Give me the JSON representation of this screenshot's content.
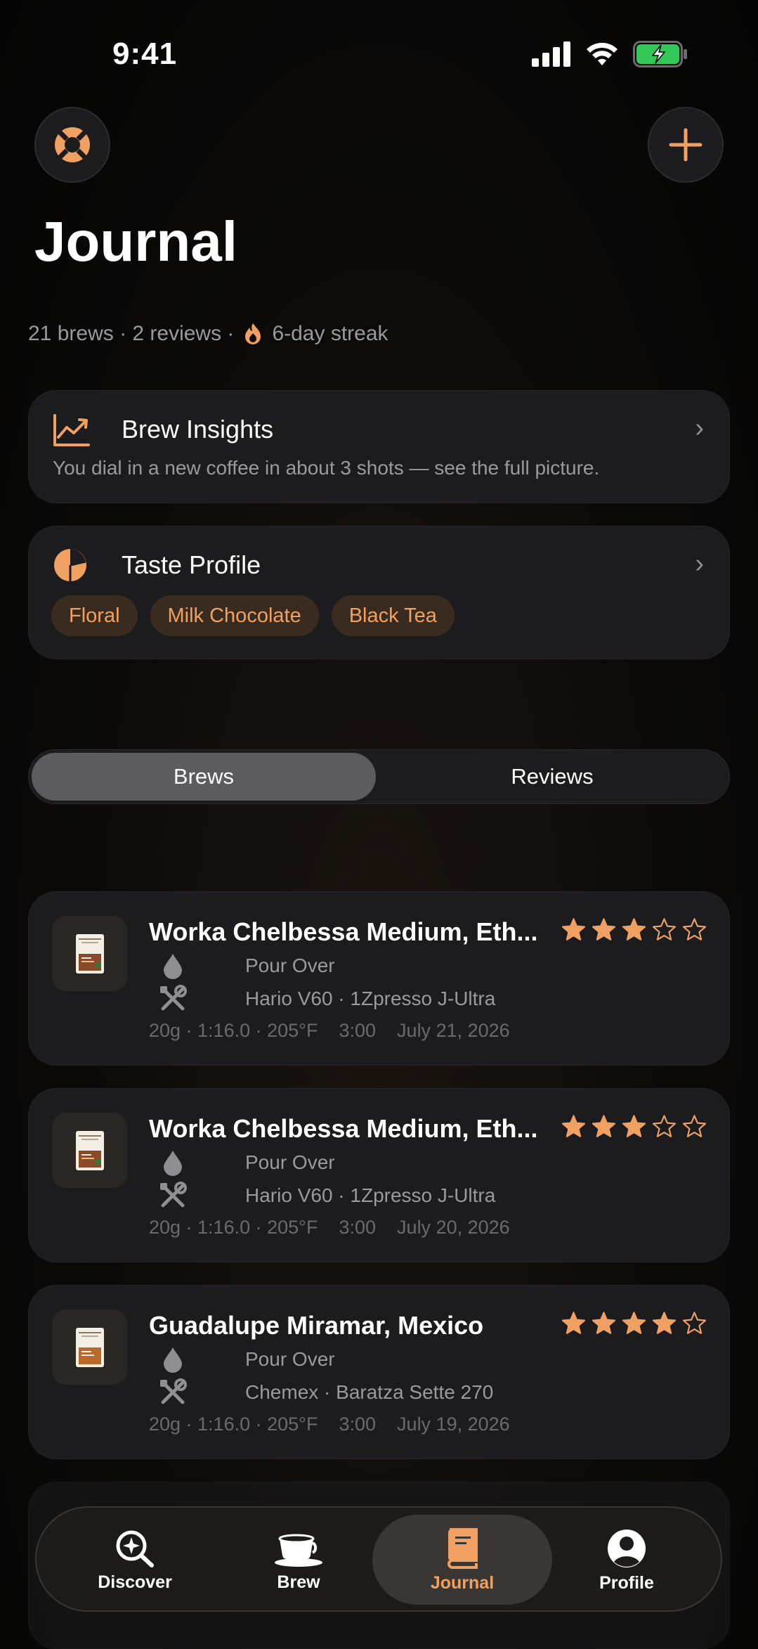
{
  "status": {
    "time": "9:41"
  },
  "header": {
    "title": "Journal"
  },
  "stats": {
    "summary": "21 brews · 2 reviews ·",
    "streak": "6-day streak"
  },
  "insights": {
    "title": "Brew Insights",
    "subtitle": "You dial in a new coffee in about 3 shots — see the full picture."
  },
  "taste": {
    "title": "Taste Profile",
    "tags": [
      "Floral",
      "Milk Chocolate",
      "Black Tea"
    ]
  },
  "segment": {
    "brews": "Brews",
    "reviews": "Reviews"
  },
  "brews": [
    {
      "name": "Worka Chelbessa Medium, Eth...",
      "rating": 3,
      "method": "Pour Over",
      "gear": "Hario V60 · 1Zpresso J-Ultra",
      "params": "20g · 1:16.0 · 205°F",
      "time": "3:00",
      "date": "July 21, 2026"
    },
    {
      "name": "Worka Chelbessa Medium, Eth...",
      "rating": 3,
      "method": "Pour Over",
      "gear": "Hario V60 · 1Zpresso J-Ultra",
      "params": "20g · 1:16.0 · 205°F",
      "time": "3:00",
      "date": "July 20, 2026"
    },
    {
      "name": "Guadalupe Miramar, Mexico",
      "rating": 4,
      "method": "Pour Over",
      "gear": "Chemex · Baratza Sette 270",
      "params": "20g · 1:16.0 · 205°F",
      "time": "3:00",
      "date": "July 19, 2026"
    }
  ],
  "tabs": {
    "discover": "Discover",
    "brew": "Brew",
    "journal": "Journal",
    "profile": "Profile"
  },
  "colors": {
    "accent": "#f0a060",
    "background": "#0b0a09",
    "card": "#1c1c1e"
  },
  "icons": {
    "help": "lifebuoy-icon",
    "add": "plus-icon",
    "streak": "flame-icon",
    "insights": "chart-line-icon",
    "taste": "pie-chart-icon"
  }
}
